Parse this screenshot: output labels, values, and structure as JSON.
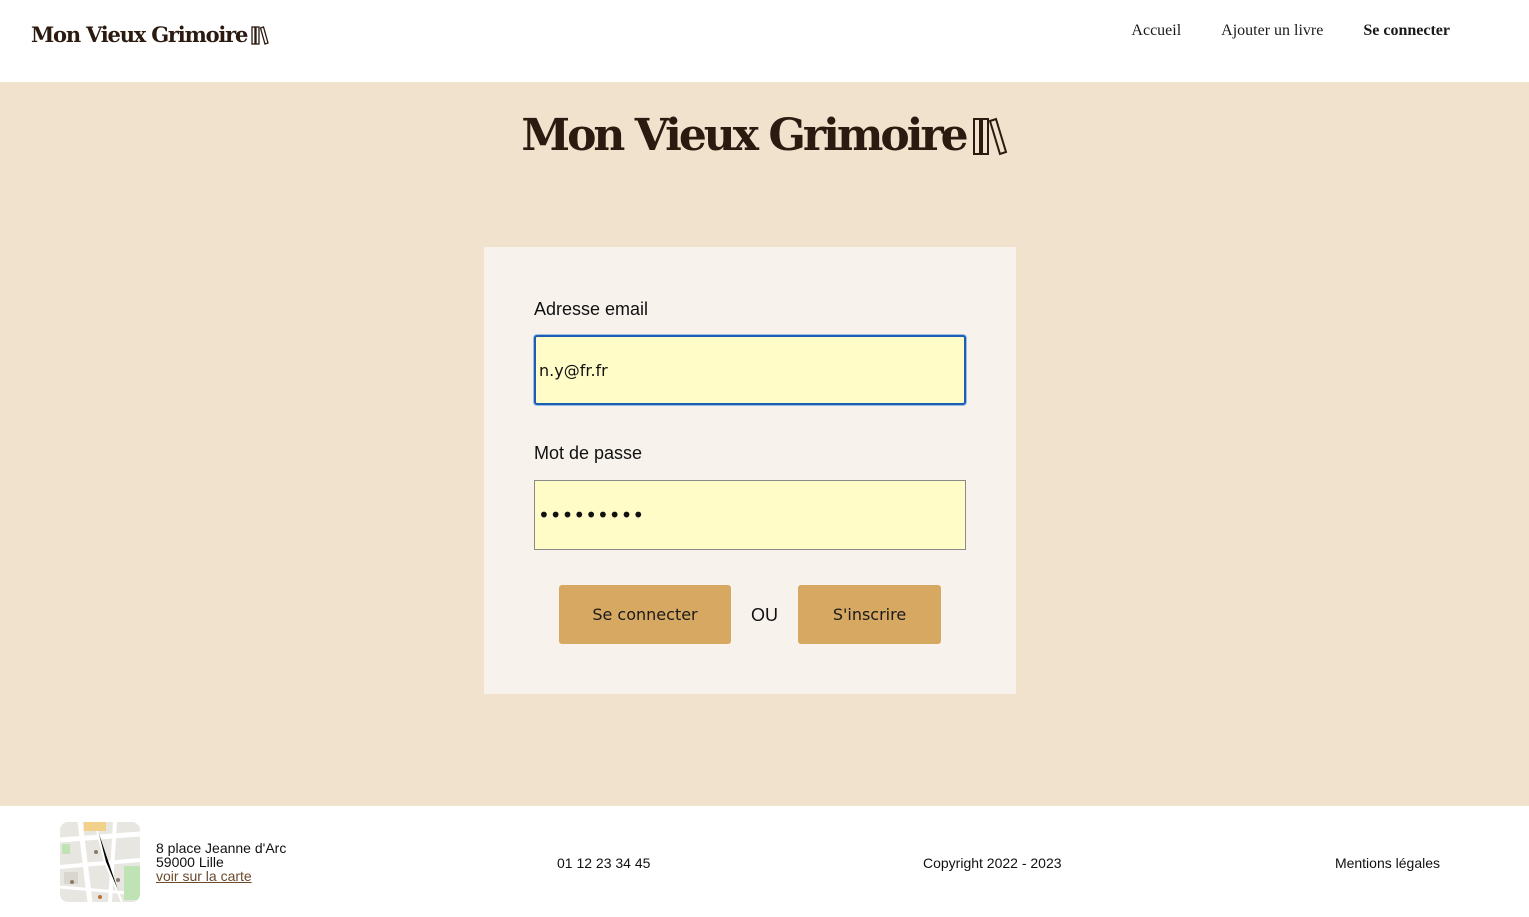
{
  "header": {
    "brand": "Mon Vieux Grimoire",
    "nav": [
      {
        "label": "Accueil"
      },
      {
        "label": "Ajouter un livre"
      },
      {
        "label": "Se connecter"
      }
    ]
  },
  "hero": {
    "title": "Mon Vieux Grimoire"
  },
  "form": {
    "email_label": "Adresse email",
    "email_value": "n.y@fr.fr",
    "password_label": "Mot de passe",
    "password_value": "•••••••••",
    "login_button": "Se connecter",
    "or_text": "OU",
    "signup_button": "S'inscrire"
  },
  "footer": {
    "address_line1": "8 place Jeanne d'Arc",
    "address_line2": "59000 Lille",
    "map_link": "voir sur la carte",
    "phone": "01 12 23 34 45",
    "copyright": "Copyright 2022 - 2023",
    "legal": "Mentions légales"
  },
  "colors": {
    "main_background": "#f1e2cd",
    "card_background": "#f7f2ec",
    "button": "#d7a862",
    "input_fill": "#fffcc7",
    "focus_border": "#1a5fb4",
    "brand_text": "#2a1a10"
  },
  "icons": {
    "brand": "books-icon",
    "map": "map-thumbnail"
  }
}
